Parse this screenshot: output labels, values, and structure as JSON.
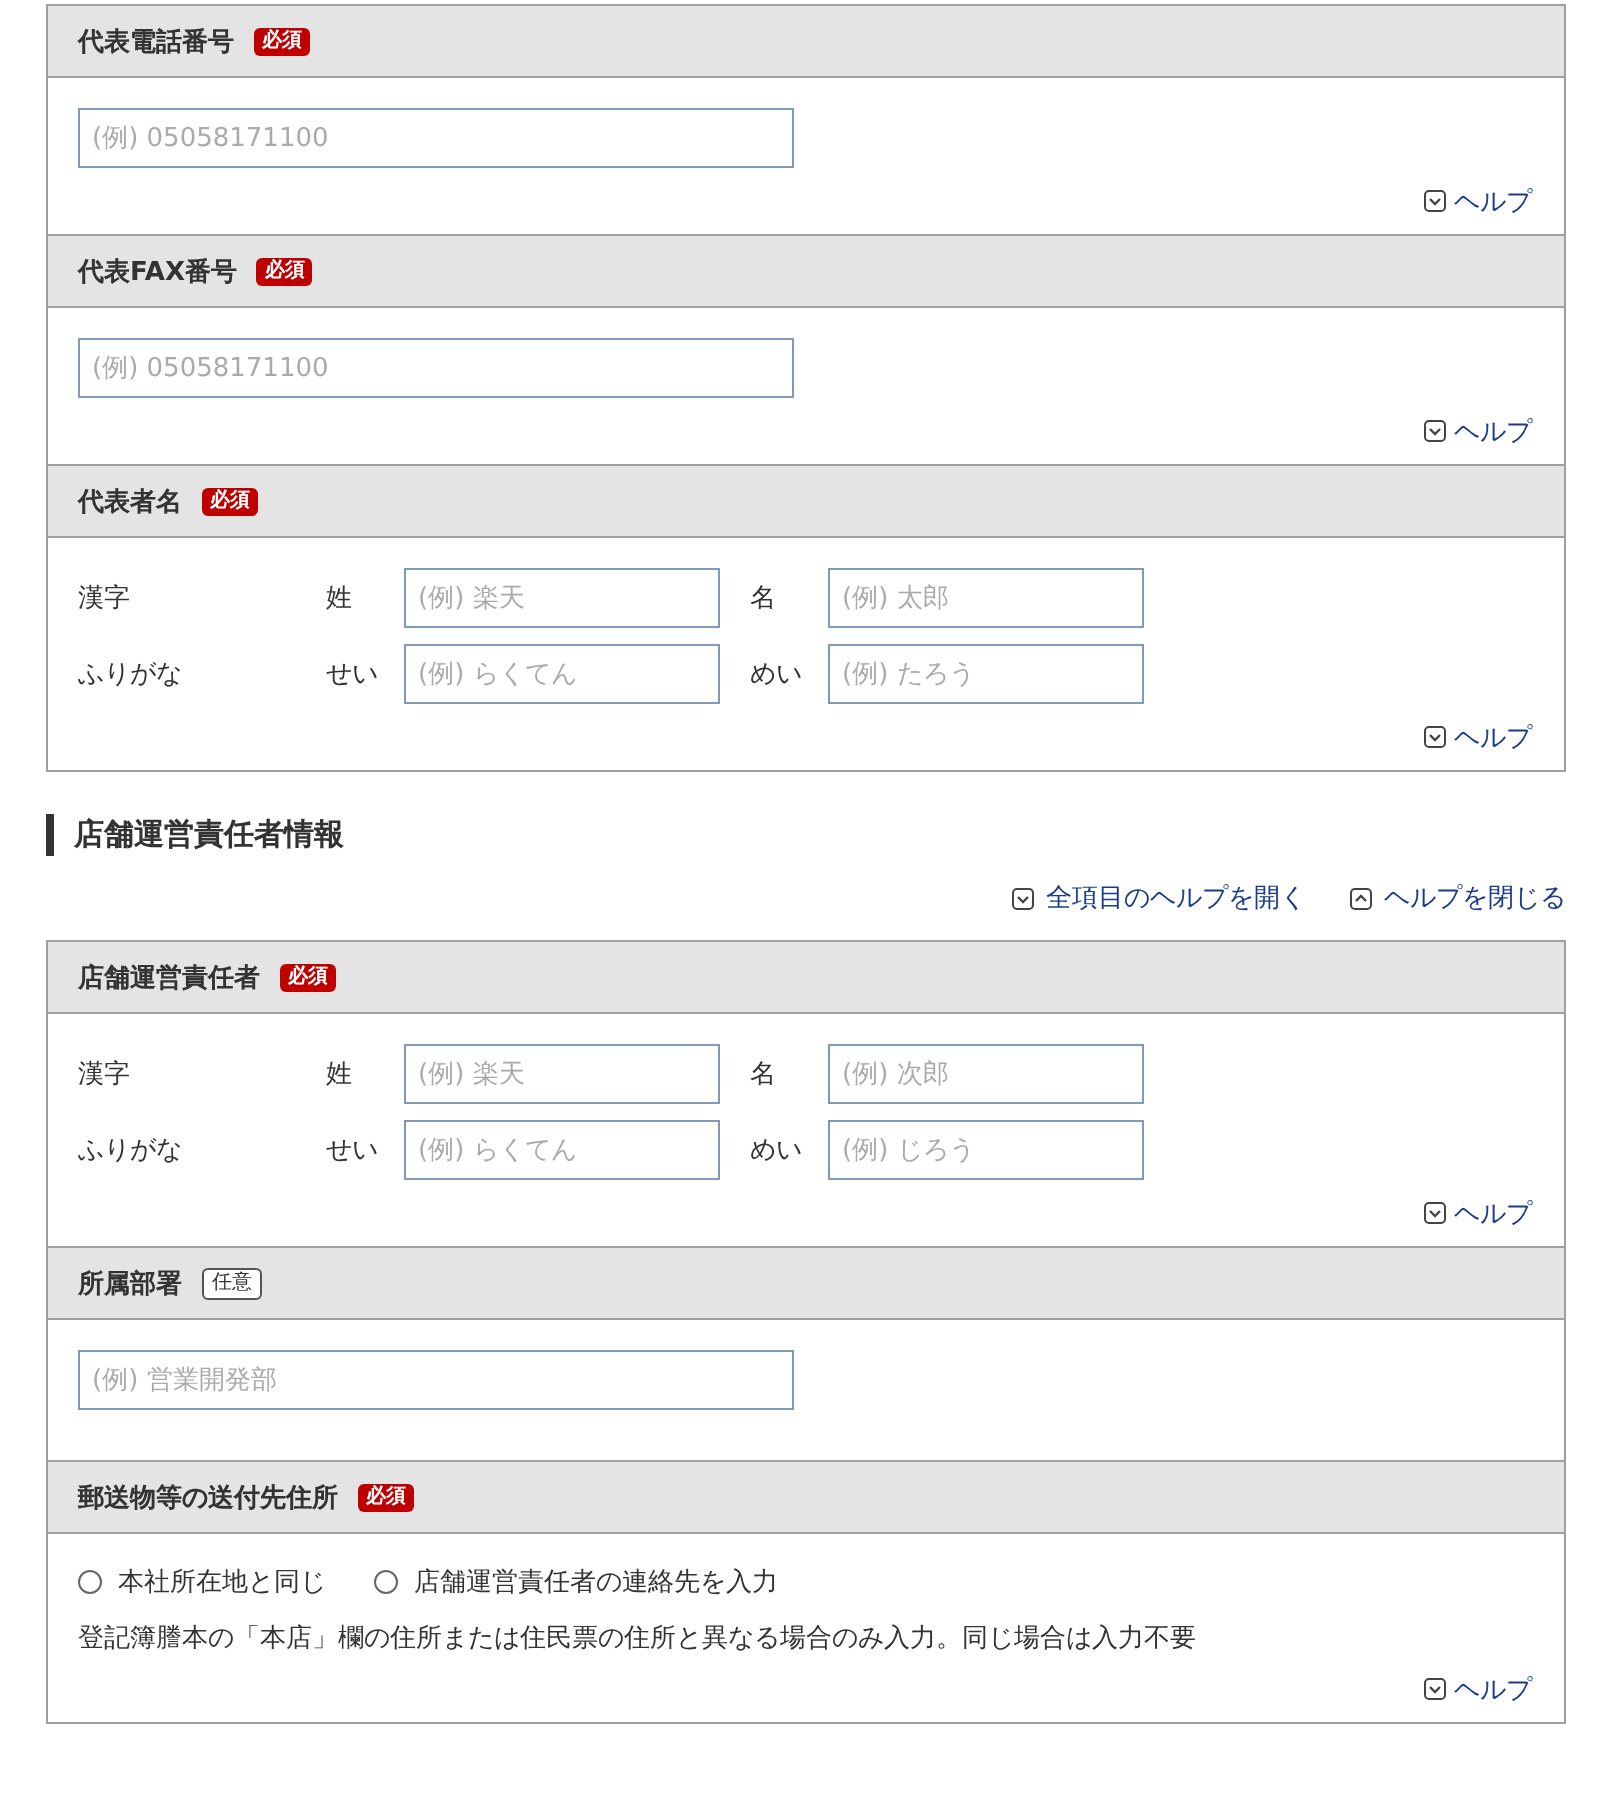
{
  "groups": [
    {
      "sections": [
        {
          "title": "代表電話番号",
          "badge": {
            "label": "必須",
            "kind": "required"
          },
          "kind": "single",
          "placeholder": "(例) 05058171100",
          "help": "ヘルプ"
        },
        {
          "title": "代表FAX番号",
          "badge": {
            "label": "必須",
            "kind": "required"
          },
          "kind": "single",
          "placeholder": "(例) 05058171100",
          "help": "ヘルプ"
        },
        {
          "title": "代表者名",
          "badge": {
            "label": "必須",
            "kind": "required"
          },
          "kind": "name",
          "rows": [
            {
              "label": "漢字",
              "fields": [
                {
                  "label": "姓",
                  "placeholder": "(例) 楽天"
                },
                {
                  "label": "名",
                  "placeholder": "(例) 太郎"
                }
              ]
            },
            {
              "label": "ふりがな",
              "fields": [
                {
                  "label": "せい",
                  "placeholder": "(例) らくてん"
                },
                {
                  "label": "めい",
                  "placeholder": "(例) たろう"
                }
              ]
            }
          ],
          "help": "ヘルプ"
        }
      ]
    },
    {
      "heading": "店舗運営責任者情報",
      "open_all": "全項目のヘルプを開く",
      "close_all": "ヘルプを閉じる",
      "sections": [
        {
          "title": "店舗運営責任者",
          "badge": {
            "label": "必須",
            "kind": "required"
          },
          "kind": "name",
          "rows": [
            {
              "label": "漢字",
              "fields": [
                {
                  "label": "姓",
                  "placeholder": "(例) 楽天"
                },
                {
                  "label": "名",
                  "placeholder": "(例) 次郎"
                }
              ]
            },
            {
              "label": "ふりがな",
              "fields": [
                {
                  "label": "せい",
                  "placeholder": "(例) らくてん"
                },
                {
                  "label": "めい",
                  "placeholder": "(例) じろう"
                }
              ]
            }
          ],
          "help": "ヘルプ"
        },
        {
          "title": "所属部署",
          "badge": {
            "label": "任意",
            "kind": "optional"
          },
          "kind": "single",
          "placeholder": "(例) 営業開発部"
        },
        {
          "title": "郵送物等の送付先住所",
          "badge": {
            "label": "必須",
            "kind": "required"
          },
          "kind": "radio",
          "options": [
            {
              "label": "本社所在地と同じ",
              "selected": false
            },
            {
              "label": "店舗運営責任者の連絡先を入力",
              "selected": false
            }
          ],
          "note": "登記簿謄本の「本店」欄の住所または住民票の住所と異なる場合のみ入力。同じ場合は入力不要",
          "help": "ヘルプ"
        }
      ]
    }
  ]
}
